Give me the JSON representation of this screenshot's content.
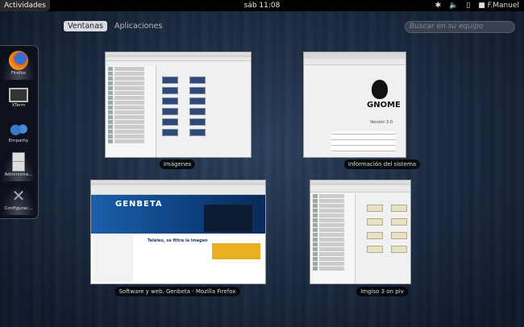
{
  "topbar": {
    "activities": "Actividades",
    "clock": "sáb 11:08",
    "user": "F.Manuel",
    "icons": [
      "bluetooth-icon",
      "volume-icon",
      "battery-icon",
      "chat-icon"
    ]
  },
  "overview": {
    "tabs": [
      {
        "label": "Ventanas",
        "active": true
      },
      {
        "label": "Aplicaciones",
        "active": false
      }
    ],
    "search_placeholder": "Buscar en su equipo"
  },
  "dash": {
    "items": [
      {
        "label": "Firefox",
        "running": true
      },
      {
        "label": "XTerm",
        "running": false
      },
      {
        "label": "Empathy",
        "running": false
      },
      {
        "label": "Administra...",
        "running": true
      },
      {
        "label": "Configurac...",
        "running": true
      }
    ]
  },
  "windows": [
    {
      "title": "Imágenes"
    },
    {
      "title": "Información del sistema",
      "logo": "GNOME",
      "version": "Versión 3.0"
    },
    {
      "title": "Software y web. Genbeta - Mozilla Firefox",
      "site": "GENBETA",
      "headline": "Teleleo, se filtra la imagen"
    },
    {
      "title": "Imgiso 3 on piv"
    }
  ],
  "colors": {
    "accent": "#d8dce2",
    "panel": "#000000"
  }
}
